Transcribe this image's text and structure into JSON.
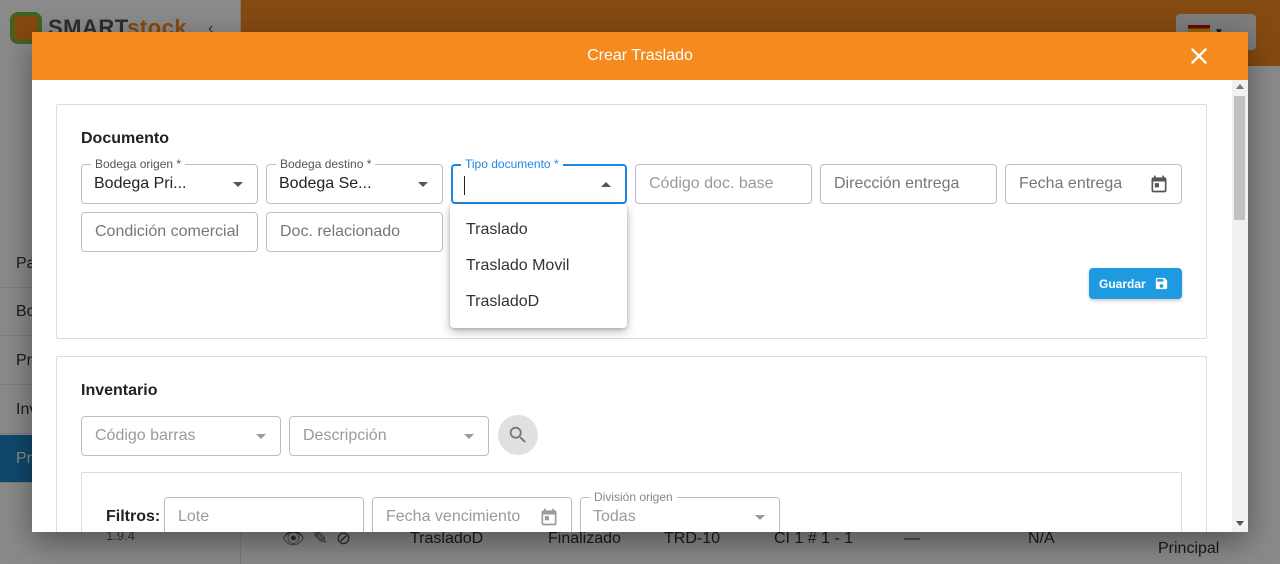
{
  "background": {
    "logo_smart": "SMART",
    "logo_stock": "stock",
    "menu_items": [
      "Pa",
      "Bo",
      "Pr",
      "Inv",
      "Pr"
    ],
    "version": "1.9.4",
    "row": {
      "tipo": "TrasladoD",
      "estado": "Finalizado",
      "codigo": "TRD-10",
      "ubicacion": "CI 1 # 1 - 1",
      "dash": "—",
      "na": "N/A",
      "bodega": "Principal"
    }
  },
  "modal": {
    "title": "Crear Traslado",
    "close_icon": "close-icon"
  },
  "documento": {
    "section_title": "Documento",
    "bodega_origen": {
      "label": "Bodega origen *",
      "value": "Bodega Pri..."
    },
    "bodega_destino": {
      "label": "Bodega destino *",
      "value": "Bodega Se..."
    },
    "tipo_documento": {
      "label": "Tipo documento *",
      "value": ""
    },
    "codigo_doc_base": {
      "placeholder": "Código doc. base"
    },
    "direccion_entrega": {
      "placeholder": "Dirección entrega"
    },
    "fecha_entrega": {
      "placeholder": "Fecha entrega"
    },
    "condicion_comercial": {
      "placeholder": "Condición comercial"
    },
    "doc_relacionado": {
      "placeholder": "Doc. relacionado"
    },
    "save_label": "Guardar",
    "tipo_options": [
      "Traslado",
      "Traslado Movil",
      "TrasladoD"
    ]
  },
  "inventario": {
    "section_title": "Inventario",
    "codigo_barras": {
      "placeholder": "Código barras"
    },
    "descripcion": {
      "placeholder": "Descripción"
    },
    "filters_label": "Filtros:",
    "lote": {
      "placeholder": "Lote"
    },
    "fecha_vencimiento": {
      "placeholder": "Fecha vencimiento"
    },
    "division_origen": {
      "label": "División origen",
      "value": "Todas"
    }
  },
  "colors": {
    "accent_orange": "#f58a1f",
    "primary_blue": "#1e88e5",
    "save_blue": "#1e9be0"
  }
}
